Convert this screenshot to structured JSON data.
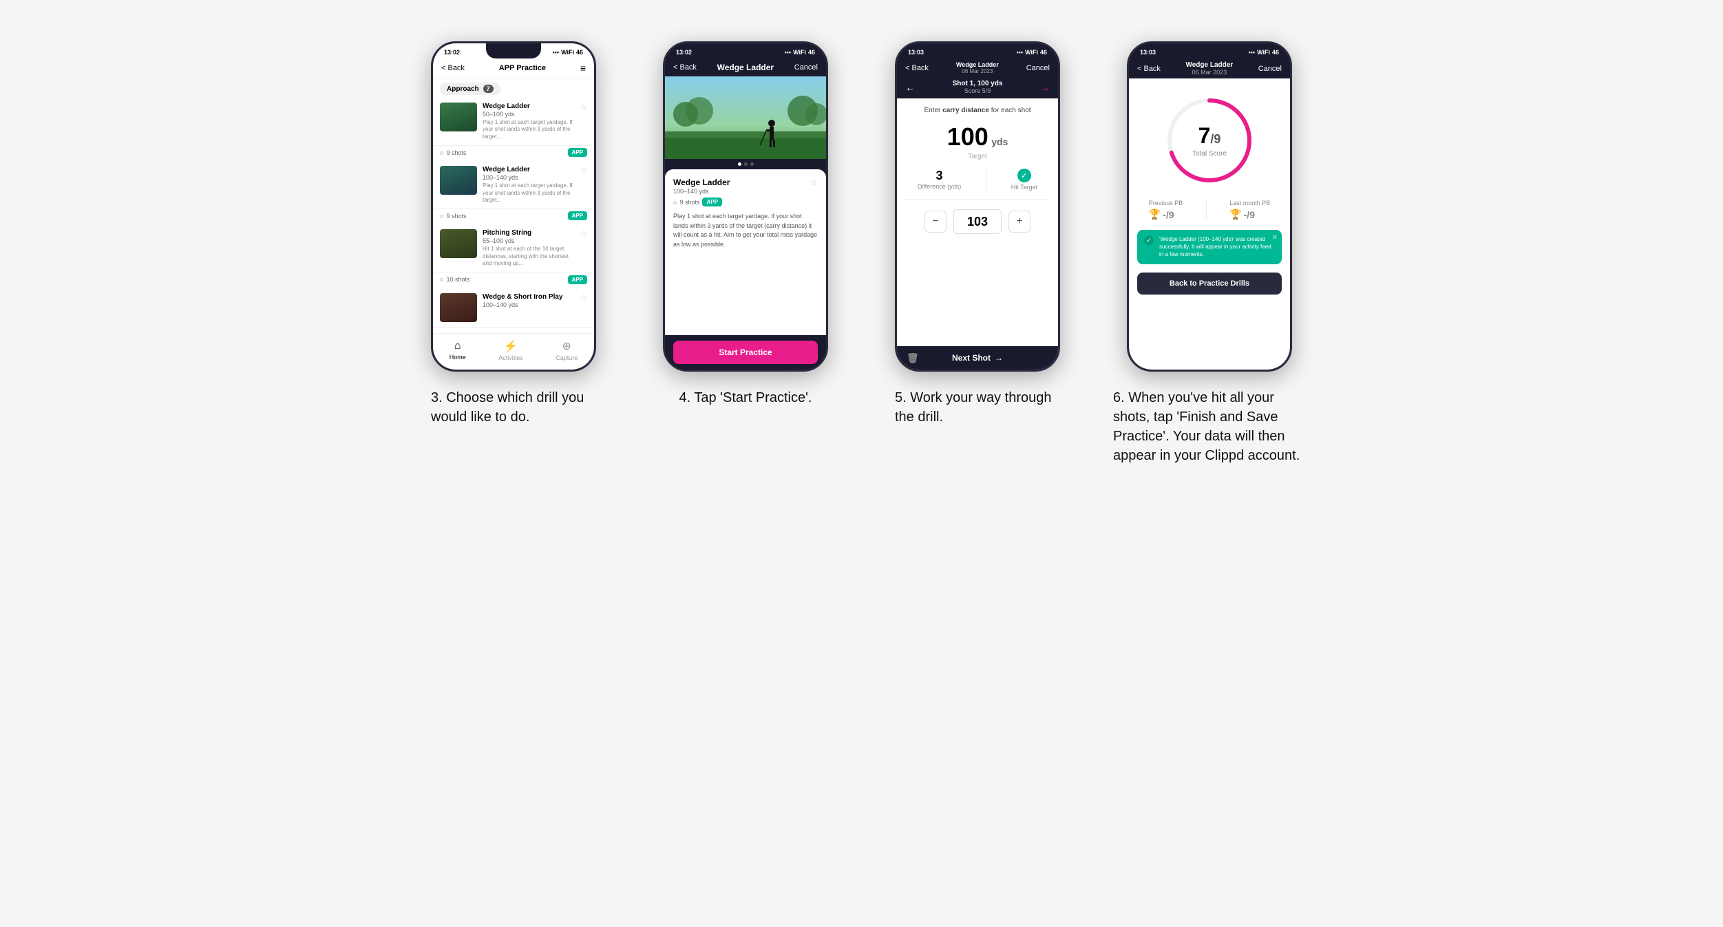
{
  "page": {
    "background": "#f5f5f5"
  },
  "phone1": {
    "status_time": "13:02",
    "nav_back": "< Back",
    "nav_title": "APP Practice",
    "category": "Approach",
    "category_count": "7",
    "drills": [
      {
        "name": "Wedge Ladder",
        "yds": "50–100 yds",
        "desc": "Play 1 shot at each target yardage. If your shot lands within 3 yards of the target...",
        "shots": "9 shots",
        "badge": "APP"
      },
      {
        "name": "Wedge Ladder",
        "yds": "100–140 yds",
        "desc": "Play 1 shot at each target yardage. If your shot lands within 3 yards of the target...",
        "shots": "9 shots",
        "badge": "APP"
      },
      {
        "name": "Pitching String",
        "yds": "55–100 yds",
        "desc": "Hit 1 shot at each of the 10 target distances, starting with the shortest and moving up...",
        "shots": "10 shots",
        "badge": "APP"
      },
      {
        "name": "Wedge & Short Iron Play",
        "yds": "100–140 yds",
        "desc": "",
        "shots": "",
        "badge": ""
      }
    ],
    "nav_home": "Home",
    "nav_activities": "Activities",
    "nav_capture": "Capture",
    "caption": "3. Choose which drill you would like to do."
  },
  "phone2": {
    "status_time": "13:02",
    "nav_back": "< Back",
    "nav_title": "Wedge Ladder",
    "nav_cancel": "Cancel",
    "drill_name": "Wedge Ladder",
    "drill_yds": "100–140 yds",
    "drill_shots": "9 shots",
    "drill_badge": "APP",
    "drill_desc": "Play 1 shot at each target yardage. If your shot lands within 3 yards of the target (carry distance) it will count as a hit. Aim to get your total miss yardage as low as possible.",
    "start_btn": "Start Practice",
    "caption": "4. Tap 'Start Practice'."
  },
  "phone3": {
    "status_time": "13:03",
    "nav_back": "< Back",
    "nav_title": "Wedge Ladder",
    "nav_subtitle": "06 Mar 2023",
    "nav_cancel": "Cancel",
    "shot_label": "Shot 1, 100 yds",
    "score_label": "Score 5/9",
    "instruction": "Enter carry distance for each shot",
    "target_val": "100",
    "target_unit": "yds",
    "target_label": "Target",
    "difference_val": "3",
    "difference_label": "Difference (yds)",
    "hit_target_label": "Hit Target",
    "input_val": "103",
    "next_shot": "Next Shot",
    "caption": "5. Work your way through the drill."
  },
  "phone4": {
    "status_time": "13:03",
    "nav_back": "< Back",
    "nav_title": "Wedge Ladder",
    "nav_subtitle": "06 Mar 2023",
    "nav_cancel": "Cancel",
    "score_num": "7",
    "score_denom": "/9",
    "score_label": "Total Score",
    "prev_pb_label": "Previous PB",
    "prev_pb_val": "-/9",
    "last_pb_label": "Last month PB",
    "last_pb_val": "-/9",
    "success_msg": "'Wedge Ladder (100–140 yds)' was created successfully. It will appear in your activity feed in a few moments.",
    "back_btn": "Back to Practice Drills",
    "caption": "6. When you've hit all your shots, tap 'Finish and Save Practice'. Your data will then appear in your Clippd account."
  }
}
